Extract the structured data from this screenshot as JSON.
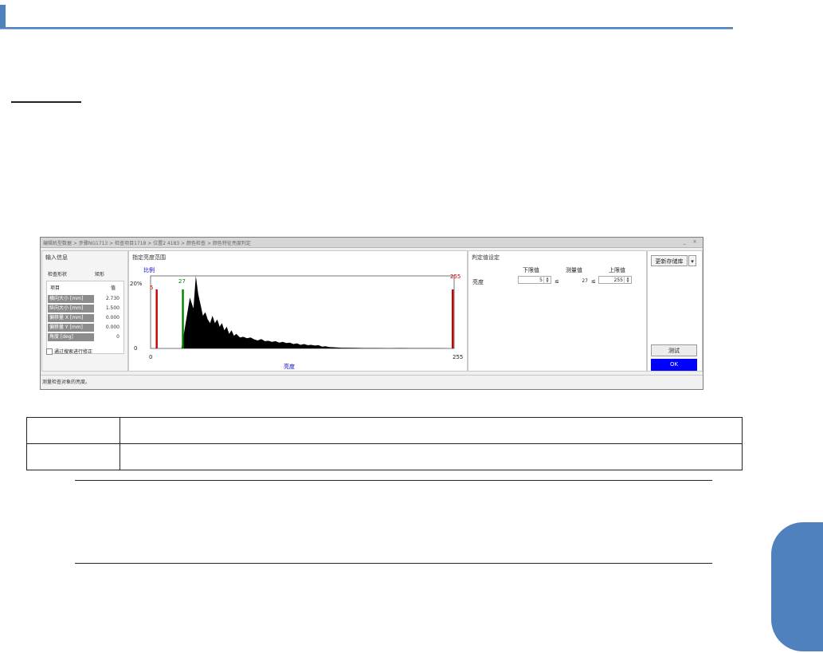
{
  "colors": {
    "accent": "#4f81bd",
    "ok_button": "#0000ff",
    "lower_marker": "#cc0000",
    "measured_marker": "#008000",
    "upper_marker": "#cc0000"
  },
  "dialog": {
    "breadcrumb": "编辑机型数据 > 步骤NG1713 > 检查项目1718 > 位置2 4183 > 颜色检查 > 颜色特征亮度判定",
    "window_controls": "_ ×",
    "input_panel": {
      "title": "输入信息",
      "shape_label": "检查形状",
      "shape_value": "矩形",
      "col_item": "项目",
      "col_value": "值",
      "rows": [
        {
          "key": "横向大小 [mm]",
          "value": "2.730"
        },
        {
          "key": "纵向大小 [mm]",
          "value": "1.500"
        },
        {
          "key": "偏移量 X [mm]",
          "value": "0.000"
        },
        {
          "key": "偏移量 Y [mm]",
          "value": "0.000"
        },
        {
          "key": "角度 [deg]",
          "value": "0"
        }
      ],
      "checkbox_label": "通过搜索进行修正"
    },
    "graph_panel": {
      "title": "指定亮度范围",
      "ratio_label": "比例",
      "y_top": "20%",
      "y_bottom": "0",
      "x_left": "0",
      "x_right": "255",
      "x_label": "亮度",
      "lower_marker_label": "5",
      "measured_marker_label": "27",
      "upper_marker_label": "255"
    },
    "judge_panel": {
      "title": "判定值设定",
      "col_lower": "下限值",
      "col_measured": "测量值",
      "col_upper": "上限值",
      "row_label": "亮度",
      "lower_value": "5",
      "measured_value": "27",
      "upper_value": "255",
      "op1": "≤",
      "op2": "≤"
    },
    "buttons": {
      "update": "更新存储库",
      "test": "测试",
      "ok": "OK"
    },
    "status": "测量检查对象的亮度。"
  },
  "chart_data": {
    "type": "area",
    "title": "",
    "xlabel": "亮度",
    "ylabel": "比例",
    "xlim": [
      0,
      255
    ],
    "ylim": [
      0,
      20
    ],
    "x": [
      0,
      26,
      27,
      30,
      33,
      36,
      38,
      40,
      42,
      44,
      46,
      48,
      50,
      52,
      54,
      56,
      58,
      60,
      62,
      64,
      66,
      68,
      70,
      72,
      75,
      78,
      81,
      84,
      87,
      90,
      93,
      96,
      99,
      102,
      105,
      108,
      111,
      114,
      117,
      120,
      123,
      126,
      129,
      132,
      135,
      138,
      141,
      144,
      147,
      150,
      155,
      160,
      170,
      180,
      190,
      200,
      210,
      220,
      230,
      240,
      250,
      255
    ],
    "series": [
      {
        "values": [
          0,
          0,
          2,
          8,
          14,
          11,
          20,
          15,
          12,
          9,
          10,
          8,
          7,
          9,
          7,
          8,
          6,
          7,
          5,
          6,
          4,
          5,
          3.5,
          4,
          3,
          3.2,
          2.8,
          3,
          2.5,
          2.2,
          2.6,
          2,
          2.1,
          1.8,
          2,
          1.6,
          1.8,
          1.5,
          1.6,
          1.2,
          1.4,
          1,
          1.2,
          0.9,
          1,
          0.8,
          0.9,
          0.5,
          0.6,
          0.4,
          0.3,
          0.2,
          0.15,
          0.1,
          0.1,
          0.05,
          0.1,
          0.05,
          0.05,
          0.05,
          0,
          0
        ]
      }
    ],
    "markers": [
      {
        "x": 5,
        "label": "5"
      },
      {
        "x": 27,
        "label": "27"
      },
      {
        "x": 255,
        "label": "255"
      }
    ]
  }
}
